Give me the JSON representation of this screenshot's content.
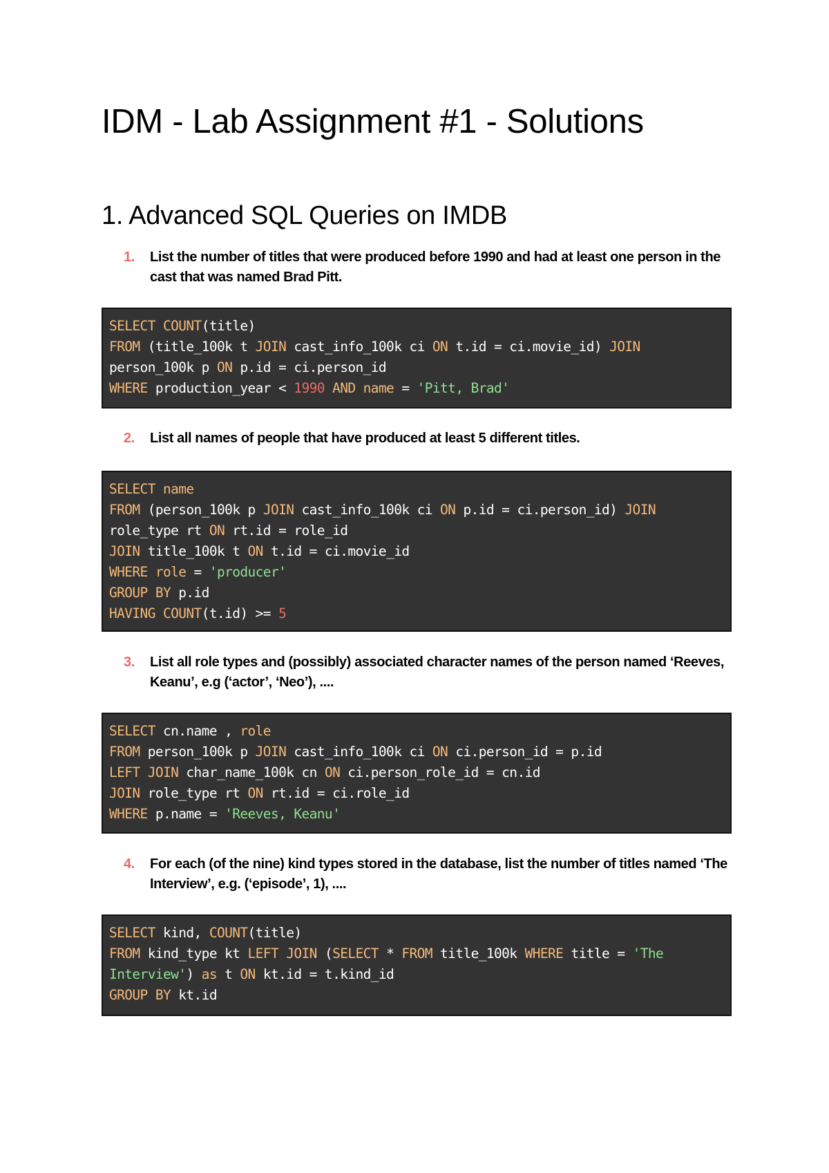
{
  "document": {
    "title": "IDM - Lab Assignment #1 - Solutions",
    "section_title": "1. Advanced SQL Queries on IMDB"
  },
  "colors": {
    "code_background": "#333333",
    "keyword": "#f5b97a",
    "string": "#8fe08f",
    "number": "#e86a6a",
    "plain": "#ffffff"
  },
  "questions": [
    {
      "number": "1.",
      "text": "List the number of titles that were produced before 1990 and had at least one person in the cast that was named Brad Pitt.",
      "code": [
        [
          [
            "kw",
            "SELECT "
          ],
          [
            "kw",
            "COUNT"
          ],
          [
            "plain",
            "(title)"
          ]
        ],
        [
          [
            "kw",
            "FROM "
          ],
          [
            "plain",
            "(title_100k t "
          ],
          [
            "kw",
            "JOIN "
          ],
          [
            "plain",
            "cast_info_100k ci "
          ],
          [
            "kw",
            "ON "
          ],
          [
            "plain",
            "t.id = ci.movie_id) "
          ],
          [
            "kw",
            "JOIN"
          ]
        ],
        [
          [
            "plain",
            "person_100k p "
          ],
          [
            "kw",
            "ON "
          ],
          [
            "plain",
            "p.id = ci.person_id"
          ]
        ],
        [
          [
            "kw",
            "WHERE "
          ],
          [
            "plain",
            "production_year < "
          ],
          [
            "num",
            "1990 "
          ],
          [
            "kw",
            "AND "
          ],
          [
            "kw",
            "name "
          ],
          [
            "plain",
            "= "
          ],
          [
            "str",
            "'Pitt, Brad'"
          ]
        ]
      ]
    },
    {
      "number": "2.",
      "text": "List all names of people that have produced at least 5 different titles.",
      "code": [
        [
          [
            "kw",
            "SELECT "
          ],
          [
            "kw",
            "name"
          ]
        ],
        [
          [
            "kw",
            "FROM "
          ],
          [
            "plain",
            "(person_100k p "
          ],
          [
            "kw",
            "JOIN "
          ],
          [
            "plain",
            "cast_info_100k ci "
          ],
          [
            "kw",
            "ON "
          ],
          [
            "plain",
            "p.id = ci.person_id) "
          ],
          [
            "kw",
            "JOIN"
          ]
        ],
        [
          [
            "plain",
            "role_type rt "
          ],
          [
            "kw",
            "ON "
          ],
          [
            "plain",
            "rt.id = role_id"
          ]
        ],
        [
          [
            "kw",
            "JOIN "
          ],
          [
            "plain",
            "title_100k t "
          ],
          [
            "kw",
            "ON "
          ],
          [
            "plain",
            "t.id = ci.movie_id"
          ]
        ],
        [
          [
            "kw",
            "WHERE "
          ],
          [
            "kw",
            "role "
          ],
          [
            "plain",
            "= "
          ],
          [
            "str",
            "'producer'"
          ]
        ],
        [
          [
            "kw",
            "GROUP BY "
          ],
          [
            "plain",
            "p.id"
          ]
        ],
        [
          [
            "kw",
            "HAVING "
          ],
          [
            "kw",
            "COUNT"
          ],
          [
            "plain",
            "(t.id) >= "
          ],
          [
            "num",
            "5"
          ]
        ]
      ]
    },
    {
      "number": "3.",
      "text": "List all role types and (possibly) associated character names of the person named ‘Reeves, Keanu’, e.g (‘actor’, ‘Neo’), ....",
      "code": [
        [
          [
            "kw",
            "SELECT "
          ],
          [
            "plain",
            "cn.name , "
          ],
          [
            "kw",
            "role"
          ]
        ],
        [
          [
            "kw",
            "FROM "
          ],
          [
            "plain",
            "person_100k p "
          ],
          [
            "kw",
            "JOIN "
          ],
          [
            "plain",
            "cast_info_100k ci "
          ],
          [
            "kw",
            "ON "
          ],
          [
            "plain",
            "ci.person_id = p.id"
          ]
        ],
        [
          [
            "kw",
            "LEFT JOIN "
          ],
          [
            "plain",
            "char_name_100k cn "
          ],
          [
            "kw",
            "ON "
          ],
          [
            "plain",
            "ci.person_role_id = cn.id"
          ]
        ],
        [
          [
            "kw",
            "JOIN "
          ],
          [
            "plain",
            "role_type rt "
          ],
          [
            "kw",
            "ON "
          ],
          [
            "plain",
            "rt.id = ci.role_id"
          ]
        ],
        [
          [
            "kw",
            "WHERE "
          ],
          [
            "plain",
            "p.name = "
          ],
          [
            "str",
            "'Reeves, Keanu'"
          ]
        ]
      ]
    },
    {
      "number": "4.",
      "text": "For each (of the nine) kind types stored in the database, list the number of titles named ‘The Interview’, e.g. (‘episode’, 1), ....",
      "code": [
        [
          [
            "kw",
            "SELECT "
          ],
          [
            "plain",
            "kind, "
          ],
          [
            "kw",
            "COUNT"
          ],
          [
            "plain",
            "(title)"
          ]
        ],
        [
          [
            "kw",
            "FROM "
          ],
          [
            "plain",
            "kind_type kt "
          ],
          [
            "kw",
            "LEFT JOIN "
          ],
          [
            "plain",
            "("
          ],
          [
            "kw",
            "SELECT "
          ],
          [
            "plain",
            "* "
          ],
          [
            "kw",
            "FROM "
          ],
          [
            "plain",
            "title_100k "
          ],
          [
            "kw",
            "WHERE "
          ],
          [
            "plain",
            "title = "
          ],
          [
            "str",
            "'The"
          ]
        ],
        [
          [
            "str",
            "Interview'"
          ],
          [
            "plain",
            ") "
          ],
          [
            "kw",
            "as "
          ],
          [
            "plain",
            "t "
          ],
          [
            "kw",
            "ON "
          ],
          [
            "plain",
            "kt.id = t.kind_id"
          ]
        ],
        [
          [
            "kw",
            "GROUP BY "
          ],
          [
            "plain",
            "kt.id"
          ]
        ]
      ]
    }
  ]
}
